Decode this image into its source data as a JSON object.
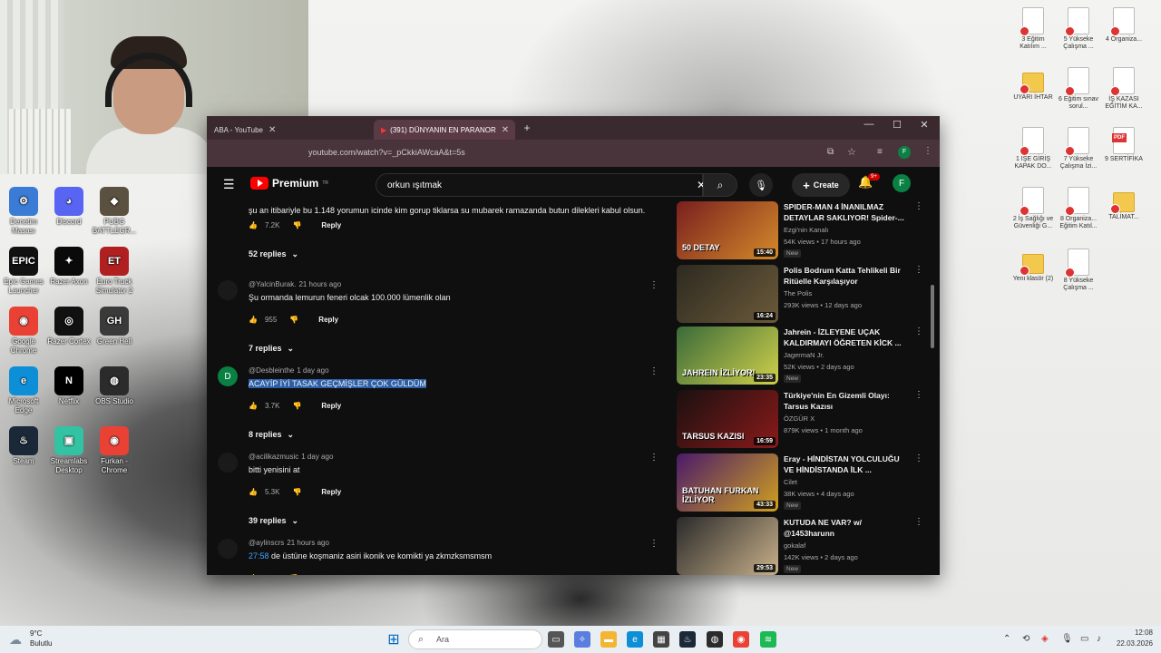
{
  "webcam": {
    "label": "webcam-overlay"
  },
  "desktop_left": [
    {
      "label": "Denetim Masası",
      "color": "#3a7bd5",
      "glyph": "⚙"
    },
    {
      "label": "Discord",
      "color": "#5865f2",
      "glyph": "◕"
    },
    {
      "label": "PUBG BATTLEGR...",
      "color": "#5b5140",
      "glyph": "◆"
    },
    {
      "label": "Epic Games Launcher",
      "color": "#111111",
      "glyph": "EPIC"
    },
    {
      "label": "Razer Axon",
      "color": "#0a0a0a",
      "glyph": "✦"
    },
    {
      "label": "Euro Truck Simulator 2",
      "color": "#b02020",
      "glyph": "ET"
    },
    {
      "label": "Google Chrome",
      "color": "#e94235",
      "glyph": "◉"
    },
    {
      "label": "Razer Cortex",
      "color": "#111111",
      "glyph": "◎"
    },
    {
      "label": "Green Hell",
      "color": "#3a3a3a",
      "glyph": "GH"
    },
    {
      "label": "Microsoft Edge",
      "color": "#0c8fd6",
      "glyph": "e"
    },
    {
      "label": "Netflix",
      "color": "#000000",
      "glyph": "N"
    },
    {
      "label": "OBS Studio",
      "color": "#2b2b2b",
      "glyph": "◍"
    },
    {
      "label": "Steam",
      "color": "#1b2838",
      "glyph": "♨"
    },
    {
      "label": "Streamlabs Desktop",
      "color": "#31c3a2",
      "glyph": "▣"
    },
    {
      "label": "Furkan - Chrome",
      "color": "#e94235",
      "glyph": "◉"
    }
  ],
  "desktop_right": [
    {
      "label": "3 Eğitim Katılım ...",
      "kind": "doc"
    },
    {
      "label": "5 Yükseke Çalışma ...",
      "kind": "doc"
    },
    {
      "label": "4 Organiza...",
      "kind": "doc"
    },
    {
      "label": "UYARI İHTAR",
      "kind": "folder"
    },
    {
      "label": "6 Eğitim sınav sorul...",
      "kind": "doc"
    },
    {
      "label": "İŞ KAZASI EĞİTİM KA...",
      "kind": "doc"
    },
    {
      "label": "1 İŞE GİRİŞ KAPAK DO...",
      "kind": "doc"
    },
    {
      "label": "7 Yükseke Çalışma İzi...",
      "kind": "doc"
    },
    {
      "label": "9 SERTİFİKA",
      "kind": "pdf"
    },
    {
      "label": "2 İş Sağlığı ve Güvenliği G...",
      "kind": "doc"
    },
    {
      "label": "8 Organiza... Eğitim Katıl...",
      "kind": "doc"
    },
    {
      "label": "TALİMAT...",
      "kind": "folder"
    },
    {
      "label": "Yeni klasör (2)",
      "kind": "folder"
    },
    {
      "label": "8 Yükseke Çalışma ...",
      "kind": "doc"
    }
  ],
  "browser": {
    "tab1": "ABA - YouTube",
    "tab2": "(391) DÜNYANIN EN PARANOR",
    "url": "youtube.com/watch?v=_pCkkiAWcaA&t=5s",
    "avatar_letter": "F"
  },
  "youtube": {
    "logo": "Premium",
    "region": "TR",
    "search_value": "orkun ışıtmak",
    "create_label": "Create",
    "notif_count": "9+",
    "avatar_letter": "F"
  },
  "comments": [
    {
      "author": "",
      "time": "",
      "text": "şu an itibariyle bu 1.148 yorumun icinde kim gorup tiklarsa su mubarek ramazanda butun dilekleri kabul olsun.",
      "likes": "7.2K",
      "reply": "Reply",
      "replies": "52 replies"
    },
    {
      "author": "@YalcinBurak.",
      "time": "21 hours ago",
      "text": "Şu ormanda lemurun feneri olcak 100.000 lümenlik olan",
      "likes": "955",
      "reply": "Reply",
      "replies": "7 replies"
    },
    {
      "author": "@Desbleinthe",
      "time": "1 day ago",
      "text": "ACAYİP İYİ TASAK GEÇMİŞLER ÇOK GÜLDÜM",
      "likes": "3.7K",
      "reply": "Reply",
      "replies": "8 replies",
      "avatar_letter": "D"
    },
    {
      "author": "@acilikazmusic",
      "time": "1 day ago",
      "text": "bitti yenisini at",
      "likes": "5.3K",
      "reply": "Reply",
      "replies": "39 replies"
    },
    {
      "author": "@aylinscrs",
      "time": "21 hours ago",
      "timestamp": "27:58",
      "text": "de üstüne koşmaniz asiri ikonik ve komikti ya zkmzksmsmsm",
      "likes": "783",
      "reply": "Reply"
    }
  ],
  "suggested": [
    {
      "title": "SPIDER-MAN 4 İNANILMAZ DETAYLAR SAKLIYOR! Spider-...",
      "channel": "Ezgi'nin Kanalı",
      "meta": "54K views • 17 hours ago",
      "badge": "New",
      "duration": "15:40",
      "thumb_text": "50 DETAY",
      "c1": "#7a1f1f",
      "c2": "#d48a2a"
    },
    {
      "title": "Polis Bodrum Katta Tehlikeli Bir Ritüelle Karşılaşıyor",
      "channel": "The Polis",
      "meta": "293K views • 12 days ago",
      "badge": "",
      "duration": "16:24",
      "thumb_text": "",
      "c1": "#2d2a20",
      "c2": "#6b5a3a"
    },
    {
      "title": "Jahrein - İZLEYENE UÇAK KALDIRMAYI ÖĞRETEN KİCK ...",
      "channel": "JagermaN Jr.",
      "meta": "52K views • 2 days ago",
      "badge": "New",
      "duration": "23:35",
      "thumb_text": "JAHREIN İZLİYOR!",
      "c1": "#3a6a3a",
      "c2": "#cfd04a"
    },
    {
      "title": "Türkiye'nin En Gizemli Olayı: Tarsus Kazısı",
      "channel": "ÖZGÜR X",
      "meta": "879K views • 1 month ago",
      "badge": "",
      "duration": "16:59",
      "thumb_text": "TARSUS KAZISI",
      "c1": "#1a1010",
      "c2": "#8a1a1a"
    },
    {
      "title": "Eray - HİNDİSTAN YOLCULUĞU VE HİNDİSTANDA İLK ...",
      "channel": "Cilet",
      "meta": "38K views • 4 days ago",
      "badge": "New",
      "duration": "43:33",
      "thumb_text": "BATUHAN FURKAN İZLİYOR",
      "c1": "#4a1a6a",
      "c2": "#d0a020"
    },
    {
      "title": "KUTUDA NE VAR? w/ @1453harunn",
      "channel": "gokalaf",
      "meta": "142K views • 2 days ago",
      "badge": "New",
      "duration": "29:53",
      "thumb_text": "",
      "c1": "#2a2a2a",
      "c2": "#c8b08a"
    }
  ],
  "taskbar": {
    "weather_temp": "9°C",
    "weather_desc": "Bulutlu",
    "search_placeholder": "Ara",
    "time": "12:08",
    "date": "22.03.2026"
  }
}
